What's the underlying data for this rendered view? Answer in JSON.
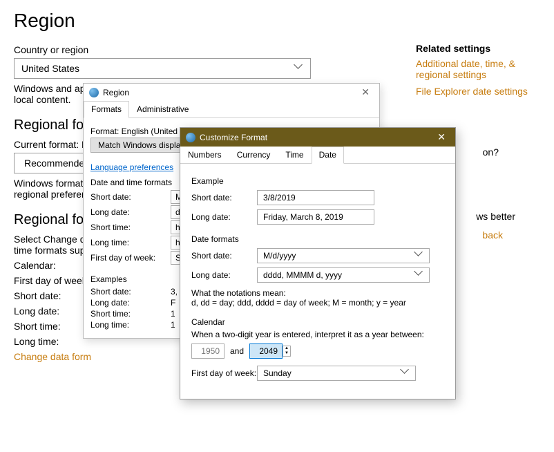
{
  "bg": {
    "title": "Region",
    "country_label": "Country or region",
    "country_value": "United States",
    "country_desc_1": "Windows and app",
    "country_desc_2": "local content.",
    "regfmt_heading": "Regional form",
    "current_format_label": "Current format: E",
    "recommended_btn": "Recommended",
    "formats_desc_1": "Windows formats",
    "formats_desc_2": "regional preferen",
    "regfmt_heading_2": "Regional form",
    "select_change_1": "Select Change da",
    "select_change_2": "time formats sup",
    "cal_label": "Calendar:",
    "first_day_label": "First day of week:",
    "short_date_label": "Short date:",
    "long_date_label": "Long date:",
    "short_time_label": "Short time:",
    "long_time_label": "Long time:",
    "change_link": "Change data form",
    "partial_question": "on?",
    "partial_better": "ws better",
    "partial_back": "back"
  },
  "sidebar": {
    "title": "Related settings",
    "link1": "Additional date, time, & regional settings",
    "link2": "File Explorer date settings"
  },
  "region_dialog": {
    "title": "Region",
    "tab_formats": "Formats",
    "tab_admin": "Administrative",
    "format_label": "Format: English (United",
    "match_btn": "Match Windows display",
    "lang_pref_link": "Language preferences",
    "dt_formats_title": "Date and time formats",
    "short_date_label": "Short date:",
    "short_date_val": "M",
    "long_date_label": "Long date:",
    "long_date_val": "d",
    "short_time_label": "Short time:",
    "short_time_val": "h",
    "long_time_label": "Long time:",
    "long_time_val": "h",
    "first_day_label": "First day of week:",
    "first_day_val": "S",
    "examples_title": "Examples",
    "ex_short_date_label": "Short date:",
    "ex_short_date_val": "3,",
    "ex_long_date_label": "Long date:",
    "ex_long_date_val": "F",
    "ex_short_time_label": "Short time:",
    "ex_short_time_val": "1",
    "ex_long_time_label": "Long time:",
    "ex_long_time_val": "1"
  },
  "customize_dialog": {
    "title": "Customize Format",
    "tab_numbers": "Numbers",
    "tab_currency": "Currency",
    "tab_time": "Time",
    "tab_date": "Date",
    "example_section": "Example",
    "short_date_label": "Short date:",
    "short_date_example": "3/8/2019",
    "long_date_label": "Long date:",
    "long_date_example": "Friday, March 8, 2019",
    "date_formats_section": "Date formats",
    "fmt_short_label": "Short date:",
    "fmt_short_val": "M/d/yyyy",
    "fmt_long_label": "Long date:",
    "fmt_long_val": "dddd, MMMM d, yyyy",
    "notation_title": "What the notations mean:",
    "notation_text": "d, dd = day;  ddd, dddd = day of week;  M = month;  y = year",
    "calendar_section": "Calendar",
    "year_range_text": "When a two-digit year is entered, interpret it as a year between:",
    "year_from": "1950",
    "and": "and",
    "year_to": "2049",
    "first_day_label": "First day of week:",
    "first_day_val": "Sunday"
  }
}
